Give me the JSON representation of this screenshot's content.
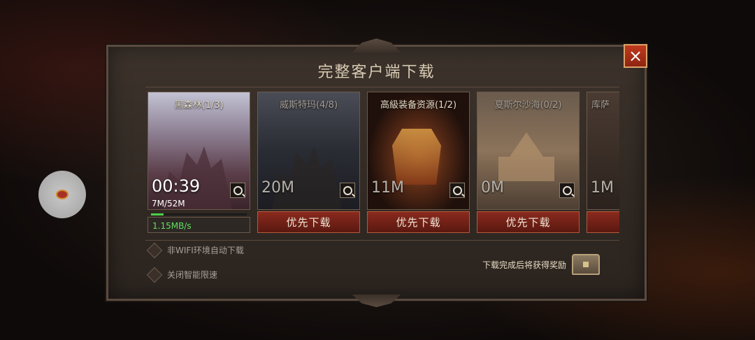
{
  "dialog": {
    "title": "完整客户端下载",
    "close_icon": "×"
  },
  "packs": [
    {
      "name": "黑森林(1/3)",
      "state": "downloading",
      "timer": "00:39",
      "progress_text": "7M/52M",
      "progress_fraction": 0.135,
      "speed": "1.15MB/s"
    },
    {
      "name": "威斯特玛(4/8)",
      "size": "20M",
      "button": "优先下载"
    },
    {
      "name": "高級装备资源(1/2)",
      "size": "11M",
      "button": "优先下载"
    },
    {
      "name": "夏斯尔沙海(0/2)",
      "size": "0M",
      "button": "优先下载"
    },
    {
      "name": "库萨",
      "size": "1M",
      "button": ""
    }
  ],
  "options": [
    {
      "label": "非WIFI环境自动下载",
      "checked": false
    },
    {
      "label": "关闭智能限速",
      "checked": false
    }
  ],
  "reward": {
    "text": "下载完成后将获得奖励",
    "icon": "treasure-chest-icon"
  },
  "colors": {
    "button_red": "#8a2a1e",
    "close_red": "#c0391e",
    "progress_green": "#4bd04b"
  }
}
